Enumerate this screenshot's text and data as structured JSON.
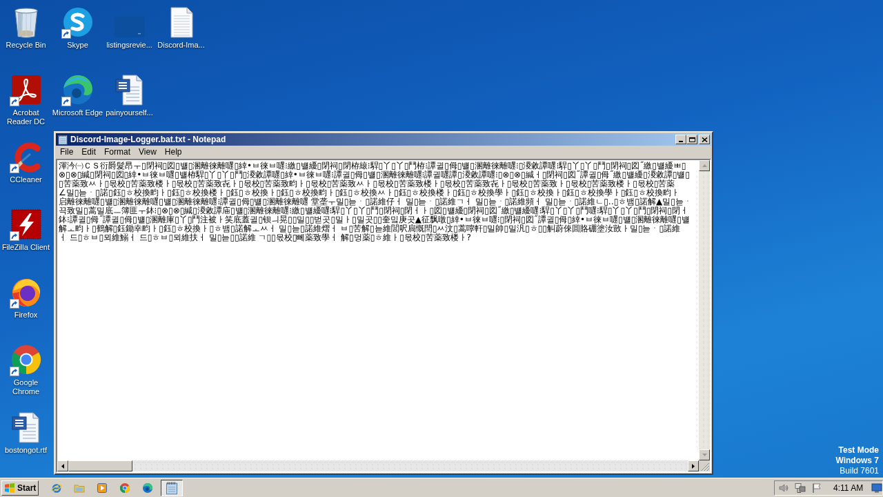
{
  "desktop": {
    "icons": [
      {
        "label": "Recycle Bin",
        "kind": "recycle-bin",
        "shortcut": false
      },
      {
        "label": "Skype",
        "kind": "skype",
        "shortcut": true
      },
      {
        "label": "listingsrevie...",
        "kind": "thumbnail",
        "shortcut": false
      },
      {
        "label": "Discord-Ima...",
        "kind": "text-file",
        "shortcut": false
      },
      {
        "label": "Acrobat\nReader DC",
        "kind": "acrobat",
        "shortcut": true
      },
      {
        "label": "Microsoft Edge",
        "kind": "edge",
        "shortcut": true
      },
      {
        "label": "painyourself...",
        "kind": "word",
        "shortcut": false
      },
      {
        "label": "CCleaner",
        "kind": "ccleaner",
        "shortcut": true
      },
      {
        "label": "FileZilla Client",
        "kind": "filezilla",
        "shortcut": true
      },
      {
        "label": "Firefox",
        "kind": "firefox",
        "shortcut": true
      },
      {
        "label": "Google\nChrome",
        "kind": "chrome",
        "shortcut": true
      },
      {
        "label": "bostongot.rtf",
        "kind": "word",
        "shortcut": false
      }
    ]
  },
  "notepad": {
    "title": "Discord-Image-Logger.bat.txt - Notepad",
    "menu": [
      "File",
      "Edit",
      "Format",
      "View",
      "Help"
    ],
    "lines": [
      "渾汵㈠ＣＳ衍爵髮昂ㅜ▯閉祠▯図▯뱰▯溷離徠離嚃▯緈•ㅂ徠ㅂ嚃⁝繳▯뱰纋▯閉祠▯閉栫縗⁝駻▯丫▯丫▯鬥栫⁝譚귈▯㑄▯뱰▯溷離徠離嚃⁝▯溭敹譚嚃⁝駻▯丫▯丫▯鬥▯閉祠▯図˝繳▯뱰纋ㅃ▯",
      "⊗▯⊗▯緘▯閉祠▯図▯緈•ㅂ徠ㅂ嚃▯뱰栫駻▯丫▯丫▯鬥▯溭敹譚嚃▯緈•ㅂ徠ㅂ嚃⁝譚귈▯㑄▯뱰▯溷離徠離嚃⁝譚귈嚃譚▯溭敹譚嚃⁝▯⊗▯⊗▯緘ㅓ▯閉祠▯図˝譚귈▯㑄˝繳▯뱰纋▯溭敹譚▯뱰▯",
      "▯苦薬致ㅆㅏ▯몫校▯苦薬致楼ㅏ▯몫校▯苦薬致㐂ㅏ▯몫校▯苦薬致畇ㅏ▯몫校▯苦薬致ㅆㅏ▯몫校▯苦薬致楼ㅏ▯몫校▯苦薬致㐂ㅏ▯몫校▯苦薬致ㅏ▯몫校▯苦薬致楼ㅏ▯몫校▯苦薬",
      "∠밀▯늗ㆍ▯諾▯鈺▯ㅎ校換畇ㅏ▯鈺▯ㅎ校換楼ㅏ▯鈺▯ㅎ校換ㅏ▯鈺▯ㅎ校換畇ㅏ▯鈺▯ㅎ校換ㅆㅏ▯鈺▯ㅎ校換楼ㅏ▯鈺▯ㅎ校換學ㅏ▯鈺▯ㅎ校換ㅏ▯鈺▯ㅎ校換學ㅏ▯鈺▯ㅎ校換畇ㅏ",
      "启離徠離嚃▯뱰▯溷離徠離嚃▯뱰▯溷離徠離嚃⁝譚귈▯㑄▯뱰▯溷離徠離嚃 堂垄ㅜ밀▯늗ㆍ▯諾維仔ㅓ 밀▯늗ㆍ▯諾維ㄱㅓ 밀▯늗ㆍ▯諾維頻ㅓ 밀▯늗ㆍ▯諾維ㄴ▯‥▯ㅎ뱀▯諾解▲밀▯늗ㆍ",
      "끅致밀▯蒿밀底ㅡ簿匪ㅜ鉢⁝▯⊗▯⊗▯緘▯溭敹譚庙▯뱰▯溷離徠離嚃⁝繳▯뱰纋嚃⁝駻▯丫▯丫▯鬥▯閉祠▯閉ㅓㅏ▯図▯뱰纋▯閉祠▯図˝繳▯뱰纋嚃⁝駻▯丫▯丫▯鬥嚃⁝駻▯丫▯丫▯鬥▯閉祠▯閉ㅓ",
      "鉢⁝譚귈▯㑄˝譚귈▯㑄▯뱰▯溷離庫▯丫▯鬥注被ㅏ笑底蓋귈▯钡ㅢ晃▯▯밀▯▯벋곳▯밀ㅏ▯밀곳▯▯奎밐庚곳▲征飘暾▯緈•ㅂ徠ㅂ嚃⁝▯閉祠▯図˝譚귈▯㑄▯緈•ㅂ徠ㅂ嚃▯뱰▯溷離徠離嚃▯뱰",
      "解ㅗ畇ㅏ▯鶴解▯鈺鋤幸畇ㅏ▯鈺▯ㅎ校換ㅏ▯ㅎ뱀▯諾解ㅗㅆㅓ 밀▯늗▯諾維熠ㅓ ㅂ▯苦解▯늗維閭呎扃慨閆▯ㅆ汶▯蒿嚀軒▯밀帥▯밀汎▯ㅎ▯▯觓蔚倈囬賂硼塗汝敳ㅏ밀▯늗ㆍ▯諾維",
      "ㅓ 드▯ㅎㅂ▯뫼維鰯ㅓ 드▯ㅎㅂ▯뫼維扶ㅓ 밀▯늗▯▯諾維 ㄱ▯▯몫校▯뻬薬致學ㅓ 解▯멍薬▯ㅎ維ㅏ▯몫校▯苦薬致楼ㅏ?"
    ]
  },
  "test_mode_notice": {
    "lines": [
      {
        "text": "Test Mode",
        "bold": true
      },
      {
        "text": "Windows 7",
        "bold": true
      },
      {
        "text": "Build 7601",
        "bold": false
      }
    ]
  },
  "taskbar": {
    "start_label": "Start",
    "pinned": [
      {
        "kind": "internet-explorer"
      },
      {
        "kind": "folder"
      },
      {
        "kind": "media-player"
      },
      {
        "kind": "chrome"
      },
      {
        "kind": "edge"
      }
    ],
    "tasks": [
      {
        "kind": "notepad",
        "selected": true
      }
    ],
    "tray": {
      "icons": [
        {
          "kind": "speaker"
        },
        {
          "kind": "network"
        },
        {
          "kind": "flag"
        }
      ],
      "clock": "4:11 AM",
      "end_icon": {
        "kind": "monitor"
      }
    }
  }
}
